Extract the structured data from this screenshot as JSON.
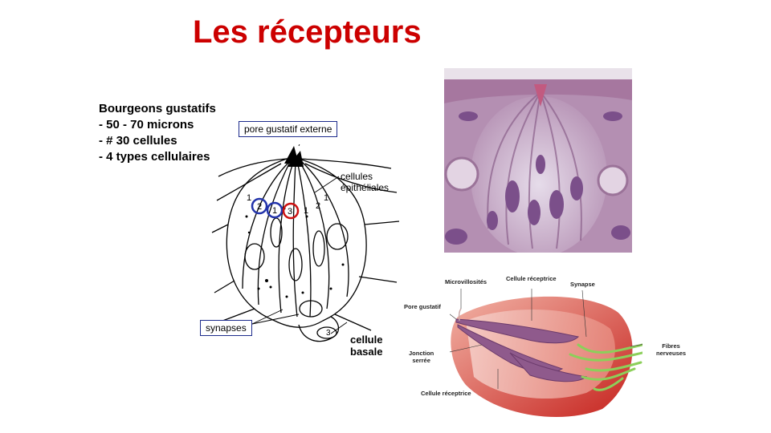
{
  "title": "Les récepteurs",
  "info": {
    "heading": "Bourgeons gustatifs",
    "items": [
      "- 50 - 70 microns",
      "- # 30 cellules",
      "- 4 types cellulaires"
    ]
  },
  "diagram": {
    "pore_label": "pore gustatif externe",
    "epithelial_label": "cellules\népithéliales",
    "synapses_label": "synapses",
    "basal_label": "cellule\nbasale",
    "numbers": [
      "1",
      "2",
      "1",
      "3",
      "1",
      "2",
      "1",
      "3"
    ]
  },
  "illustration": {
    "microvillosites": "Microvillosités",
    "cellule_receptrice_top": "Cellule réceptrice",
    "synapse": "Synapse",
    "pore_gustatif": "Pore gustatif",
    "jonction": "Jonction\nserrée",
    "fibres": "Fibres\nnerveuses",
    "cellule_receptrice_bottom": "Cellule réceptrice"
  },
  "colors": {
    "title": "#cc0000",
    "box_border": "#1d2b8c",
    "circle_blue": "#2233aa",
    "circle_red": "#cc1111"
  }
}
